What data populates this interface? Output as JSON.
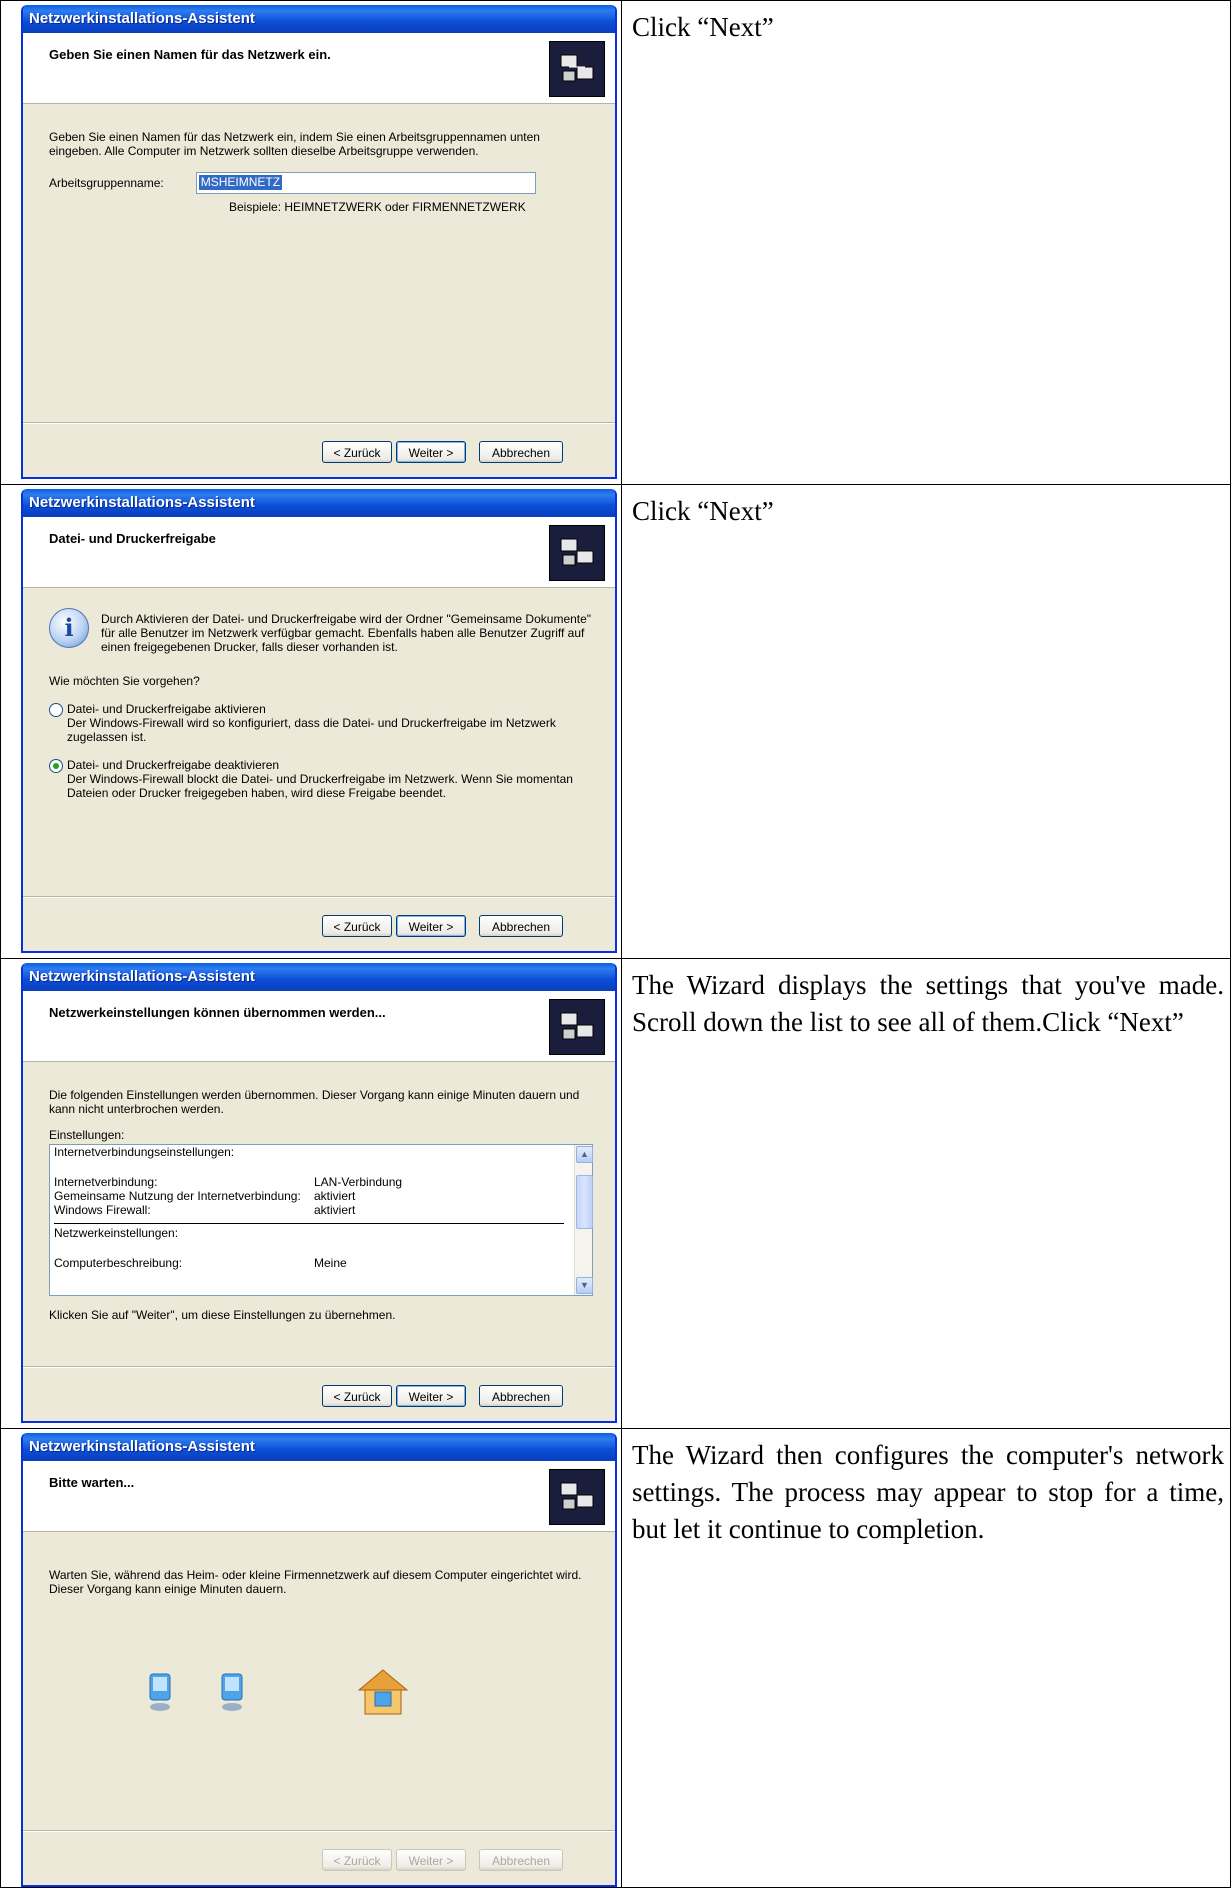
{
  "rows": [
    {
      "instruction": "Click “Next”",
      "dialog": {
        "title": "Netzwerkinstallations-Assistent",
        "header": "Geben Sie einen Namen für das Netzwerk ein.",
        "intro": "Geben Sie einen Namen für das Netzwerk ein, indem Sie einen Arbeitsgruppennamen unten eingeben. Alle Computer im Netzwerk sollten dieselbe Arbeitsgruppe verwenden.",
        "field_label": "Arbeitsgruppenname:",
        "field_value": "MSHEIMNETZ",
        "hint": "Beispiele: HEIMNETZWERK oder FIRMENNETZWERK",
        "buttons": {
          "back": "< Zurück",
          "next": "Weiter >",
          "cancel": "Abbrechen"
        }
      }
    },
    {
      "instruction": "Click “Next”",
      "dialog": {
        "title": "Netzwerkinstallations-Assistent",
        "header": "Datei- und Druckerfreigabe",
        "info": "Durch Aktivieren der Datei- und Druckerfreigabe wird der Ordner \"Gemeinsame Dokumente\" für alle Benutzer im Netzwerk verfügbar gemacht. Ebenfalls haben alle Benutzer Zugriff auf einen freigegebenen Drucker, falls dieser vorhanden ist.",
        "question": "Wie möchten Sie vorgehen?",
        "option1_title": "Datei- und Druckerfreigabe aktivieren",
        "option1_desc": "Der Windows-Firewall wird so konfiguriert, dass die Datei- und Druckerfreigabe im Netzwerk zugelassen ist.",
        "option2_title": "Datei- und Druckerfreigabe deaktivieren",
        "option2_desc": "Der Windows-Firewall blockt die Datei- und Druckerfreigabe im Netzwerk. Wenn Sie momentan Dateien oder Drucker freigegeben haben, wird diese Freigabe beendet.",
        "selected_option": 2,
        "buttons": {
          "back": "< Zurück",
          "next": "Weiter >",
          "cancel": "Abbrechen"
        }
      }
    },
    {
      "instruction": "The Wizard displays the settings that you've made. Scroll down the list to see all of them.Click “Next”",
      "dialog": {
        "title": "Netzwerkinstallations-Assistent",
        "header": "Netzwerkeinstellungen können übernommen werden...",
        "intro": "Die folgenden Einstellungen werden übernommen. Dieser Vorgang kann einige Minuten dauern und kann nicht unterbrochen werden.",
        "list_label": "Einstellungen:",
        "section1": "Internetverbindungseinstellungen:",
        "items": [
          {
            "key": "Internetverbindung:",
            "value": "LAN-Verbindung"
          },
          {
            "key": "Gemeinsame Nutzung der Internetverbindung:",
            "value": "aktiviert"
          },
          {
            "key": "Windows Firewall:",
            "value": "aktiviert"
          }
        ],
        "section2": "Netzwerkeinstellungen:",
        "item_last": {
          "key": "Computerbeschreibung:",
          "value": "Meine"
        },
        "footer_note": "Klicken Sie auf \"Weiter\", um diese Einstellungen zu übernehmen.",
        "buttons": {
          "back": "< Zurück",
          "next": "Weiter >",
          "cancel": "Abbrechen"
        }
      }
    },
    {
      "instruction": "The Wizard then configures the computer's network settings. The process may appear to stop for a time, but let it continue to completion.",
      "dialog": {
        "title": "Netzwerkinstallations-Assistent",
        "header": "Bitte warten...",
        "intro": "Warten Sie, während das Heim- oder kleine Firmennetzwerk auf diesem Computer eingerichtet wird. Dieser Vorgang kann einige Minuten dauern.",
        "buttons": {
          "back": "< Zurück",
          "next": "Weiter >",
          "cancel": "Abbrechen"
        }
      }
    }
  ],
  "colors": {
    "titlebar": "#0b4ed6",
    "dialog_bg": "#ece9d8",
    "selection": "#316ac5"
  },
  "icons": [
    "network-wizard-icon",
    "info-icon",
    "computer-icon",
    "home-network-icon",
    "scroll-up-icon",
    "scroll-down-icon"
  ]
}
